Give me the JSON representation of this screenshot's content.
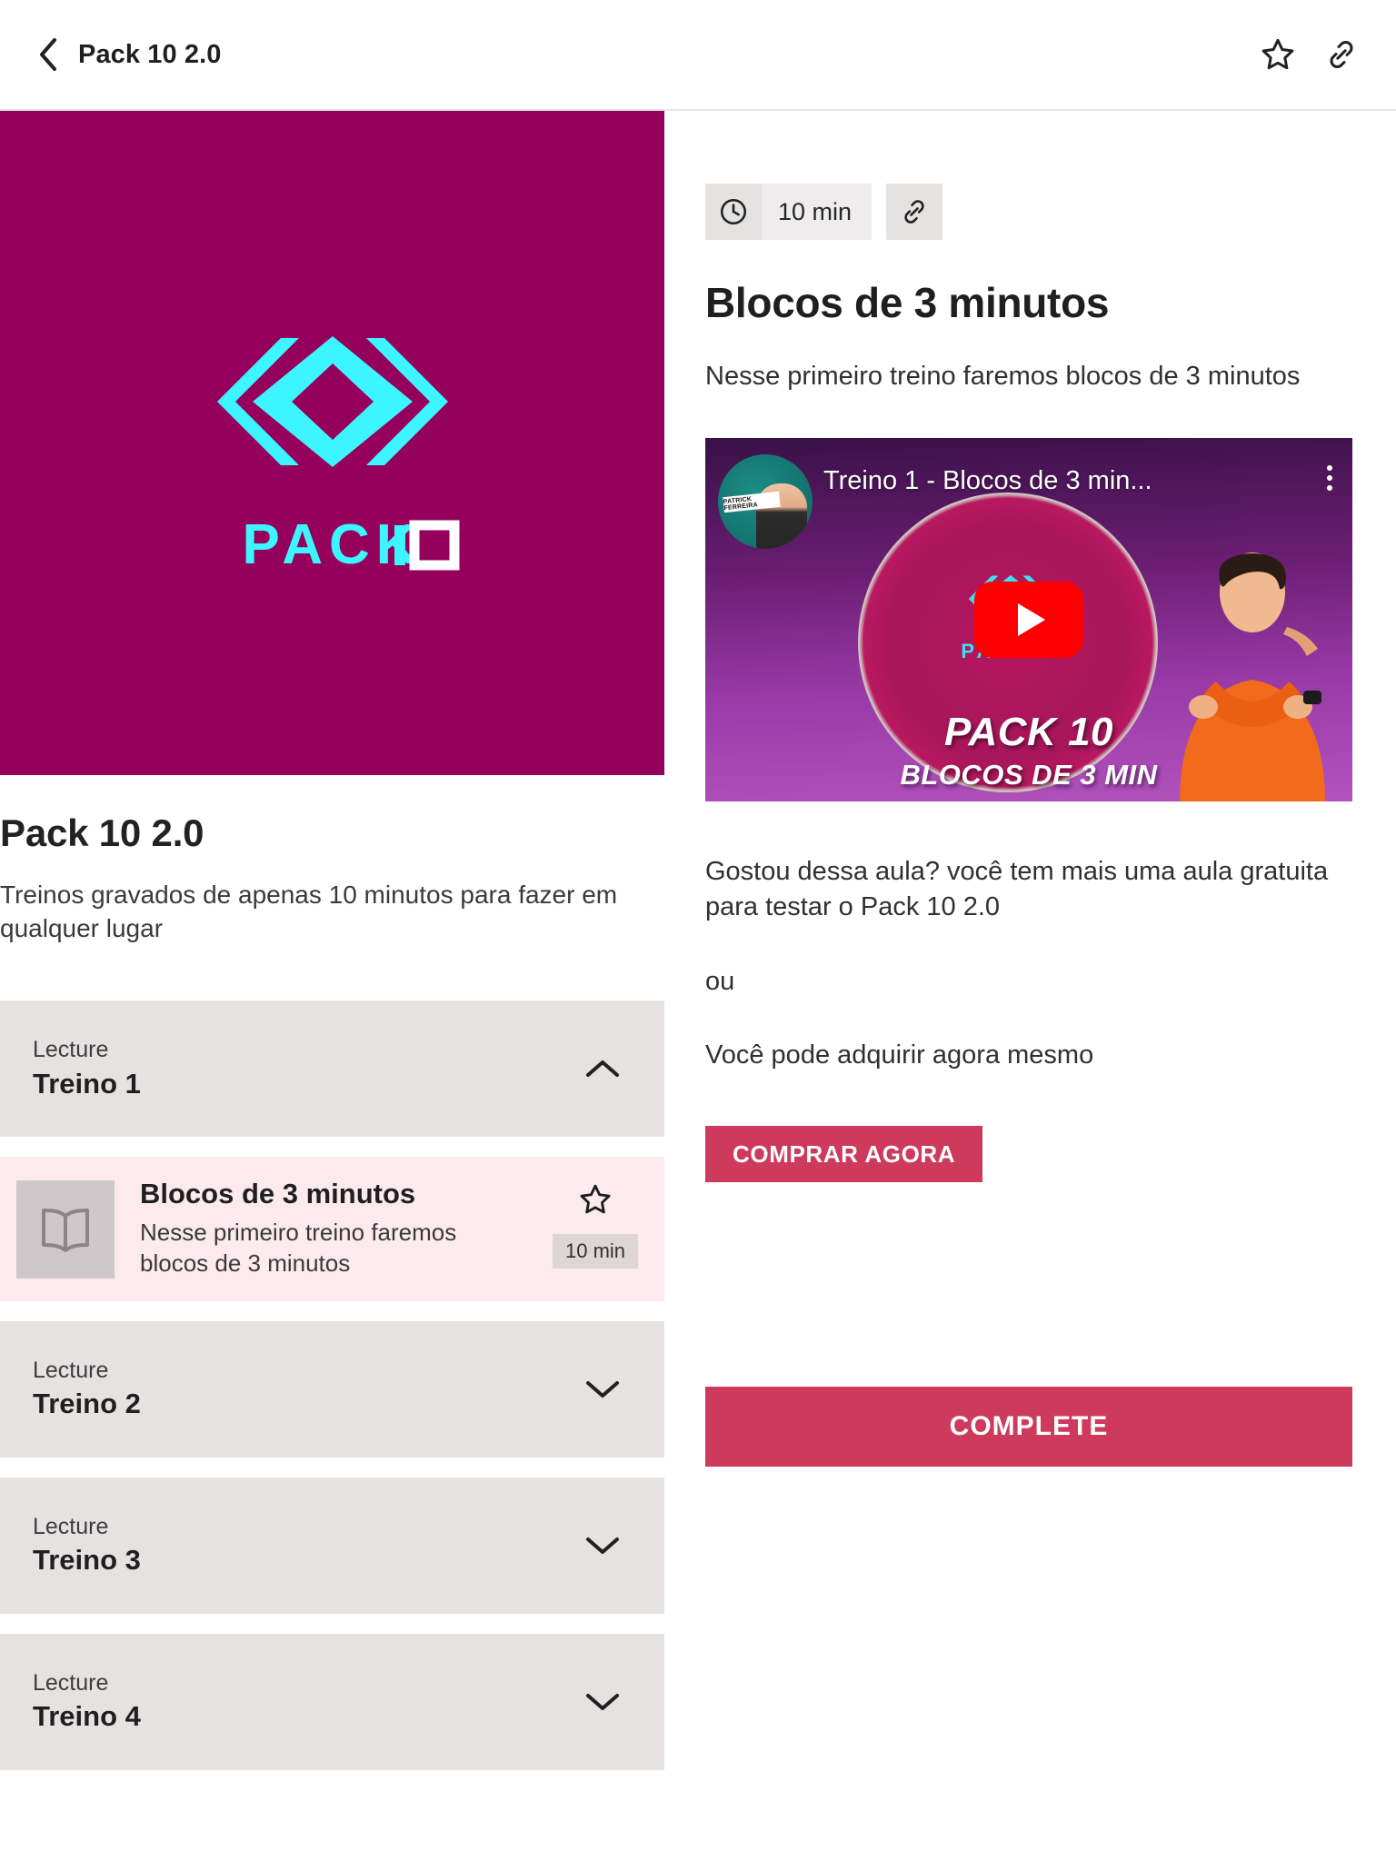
{
  "appbar": {
    "back_icon": "chevron-left-icon",
    "title": "Pack 10 2.0",
    "star_icon": "star-icon",
    "link_icon": "link-icon"
  },
  "banner": {
    "logo_name": "pack10-logo",
    "wordmark": "PACK10",
    "bg_color": "#94005b",
    "accent_color": "#3df5ff"
  },
  "course": {
    "title": "Pack 10 2.0",
    "description": "Treinos gravados de apenas 10 minutos para fazer em qualquer lugar"
  },
  "curriculum": {
    "sections": [
      {
        "kicker": "Lecture",
        "name": "Treino 1",
        "expanded": true,
        "chevron": "chevron-up-icon"
      },
      {
        "kicker": "Lecture",
        "name": "Treino 2",
        "expanded": false,
        "chevron": "chevron-down-icon"
      },
      {
        "kicker": "Lecture",
        "name": "Treino 3",
        "expanded": false,
        "chevron": "chevron-down-icon"
      },
      {
        "kicker": "Lecture",
        "name": "Treino 4",
        "expanded": false,
        "chevron": "chevron-down-icon"
      }
    ],
    "active_lesson": {
      "title": "Blocos de 3 minutos",
      "subtitle": "Nesse primeiro treino faremos blocos de 3 minutos",
      "duration": "10 min",
      "thumb_icon": "book-icon",
      "star_icon": "star-icon"
    }
  },
  "detail": {
    "duration": "10 min",
    "clock_icon": "clock-icon",
    "link_icon": "link-icon",
    "heading": "Blocos de 3 minutos",
    "lead": "Nesse primeiro treino faremos blocos de 3 minutos",
    "video": {
      "title": "Treino 1 - Blocos de 3 min...",
      "channel_tag": "PATRICK FERREIRA",
      "overlay_main": "PACK 10",
      "overlay_sub": "BLOCOS DE 3 MIN",
      "play_icon": "play-icon",
      "menu_icon": "kebab-menu-icon",
      "avatar_name": "channel-avatar"
    },
    "paragraphs": [
      "Gostou dessa aula? você tem mais uma aula gratuita para testar o Pack 10 2.0",
      "ou",
      "Você pode adquirir agora mesmo"
    ],
    "buy_label": "COMPRAR AGORA",
    "complete_label": "COMPLETE",
    "accent_color": "#cd3a5c"
  }
}
